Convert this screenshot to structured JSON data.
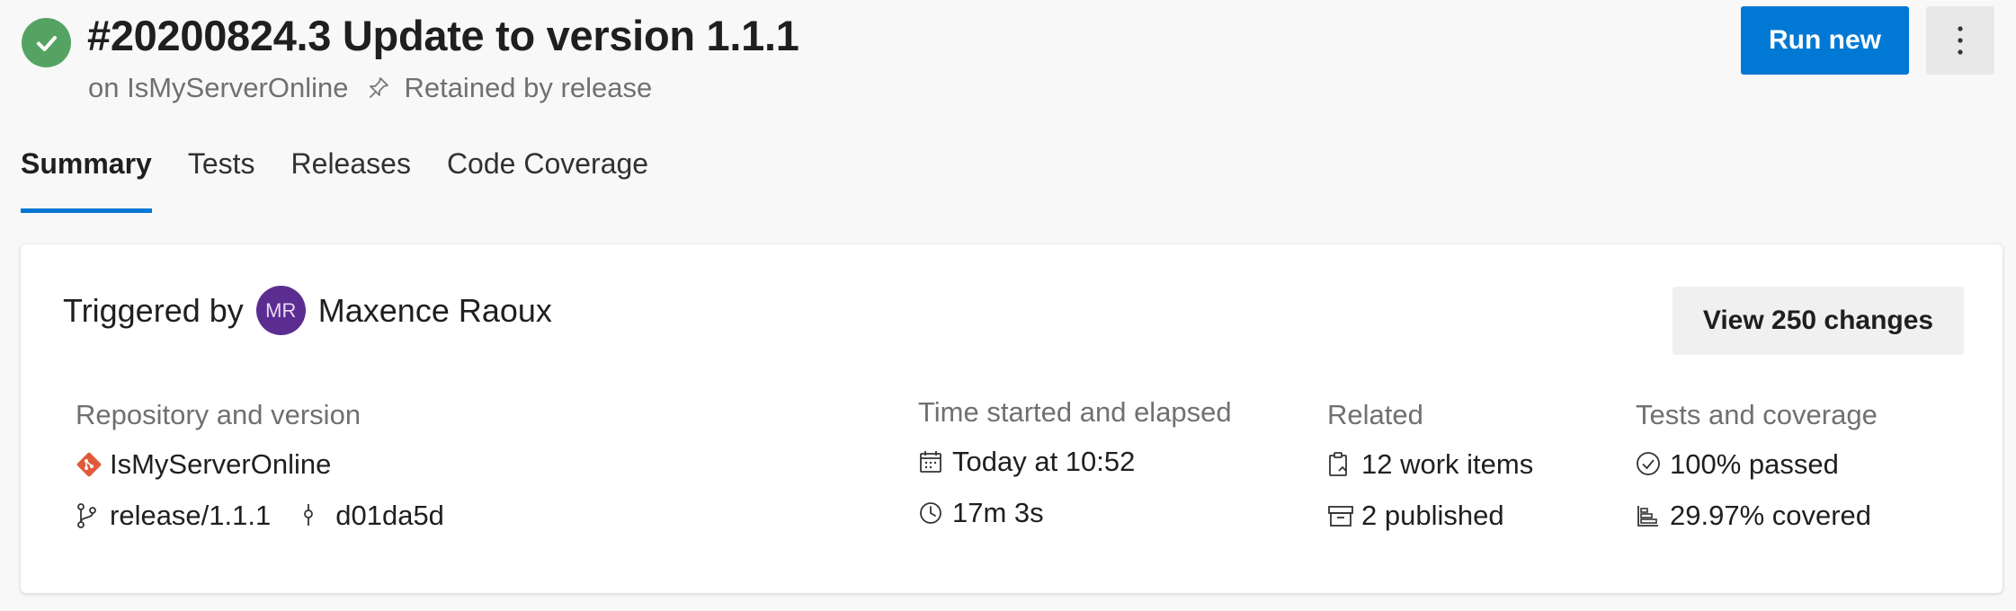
{
  "header": {
    "title": "#20200824.3 Update to version 1.1.1",
    "subtitle_repo": "on IsMyServerOnline",
    "retained": "Retained by release",
    "run_new_label": "Run new"
  },
  "tabs": [
    {
      "label": "Summary",
      "active": true
    },
    {
      "label": "Tests"
    },
    {
      "label": "Releases"
    },
    {
      "label": "Code Coverage"
    }
  ],
  "summary": {
    "triggered_by_label": "Triggered by",
    "avatar_initials": "MR",
    "user_name": "Maxence Raoux",
    "view_changes_label": "View 250 changes",
    "repository": {
      "heading": "Repository and version",
      "repo_name": "IsMyServerOnline",
      "branch": "release/1.1.1",
      "commit": "d01da5d"
    },
    "time": {
      "heading": "Time started and elapsed",
      "started": "Today at 10:52",
      "elapsed": "17m 3s"
    },
    "related": {
      "heading": "Related",
      "work_items": "12 work items",
      "published": "2 published"
    },
    "tests": {
      "heading": "Tests and coverage",
      "passed": "100% passed",
      "covered": "29.97% covered"
    }
  },
  "colors": {
    "accent": "#0078d4",
    "success": "#55a362",
    "avatar": "#5c2d91",
    "git": "#e05a3a"
  },
  "icons": {
    "status": "check-circle-icon",
    "pin": "pin-icon",
    "more": "more-vertical-icon",
    "repo": "git-icon",
    "branch": "branch-icon",
    "commit": "commit-icon",
    "calendar": "calendar-icon",
    "clock": "clock-icon",
    "work_items": "clipboard-icon",
    "published": "artifact-icon",
    "passed": "check-outline-icon",
    "coverage": "bar-chart-icon"
  }
}
